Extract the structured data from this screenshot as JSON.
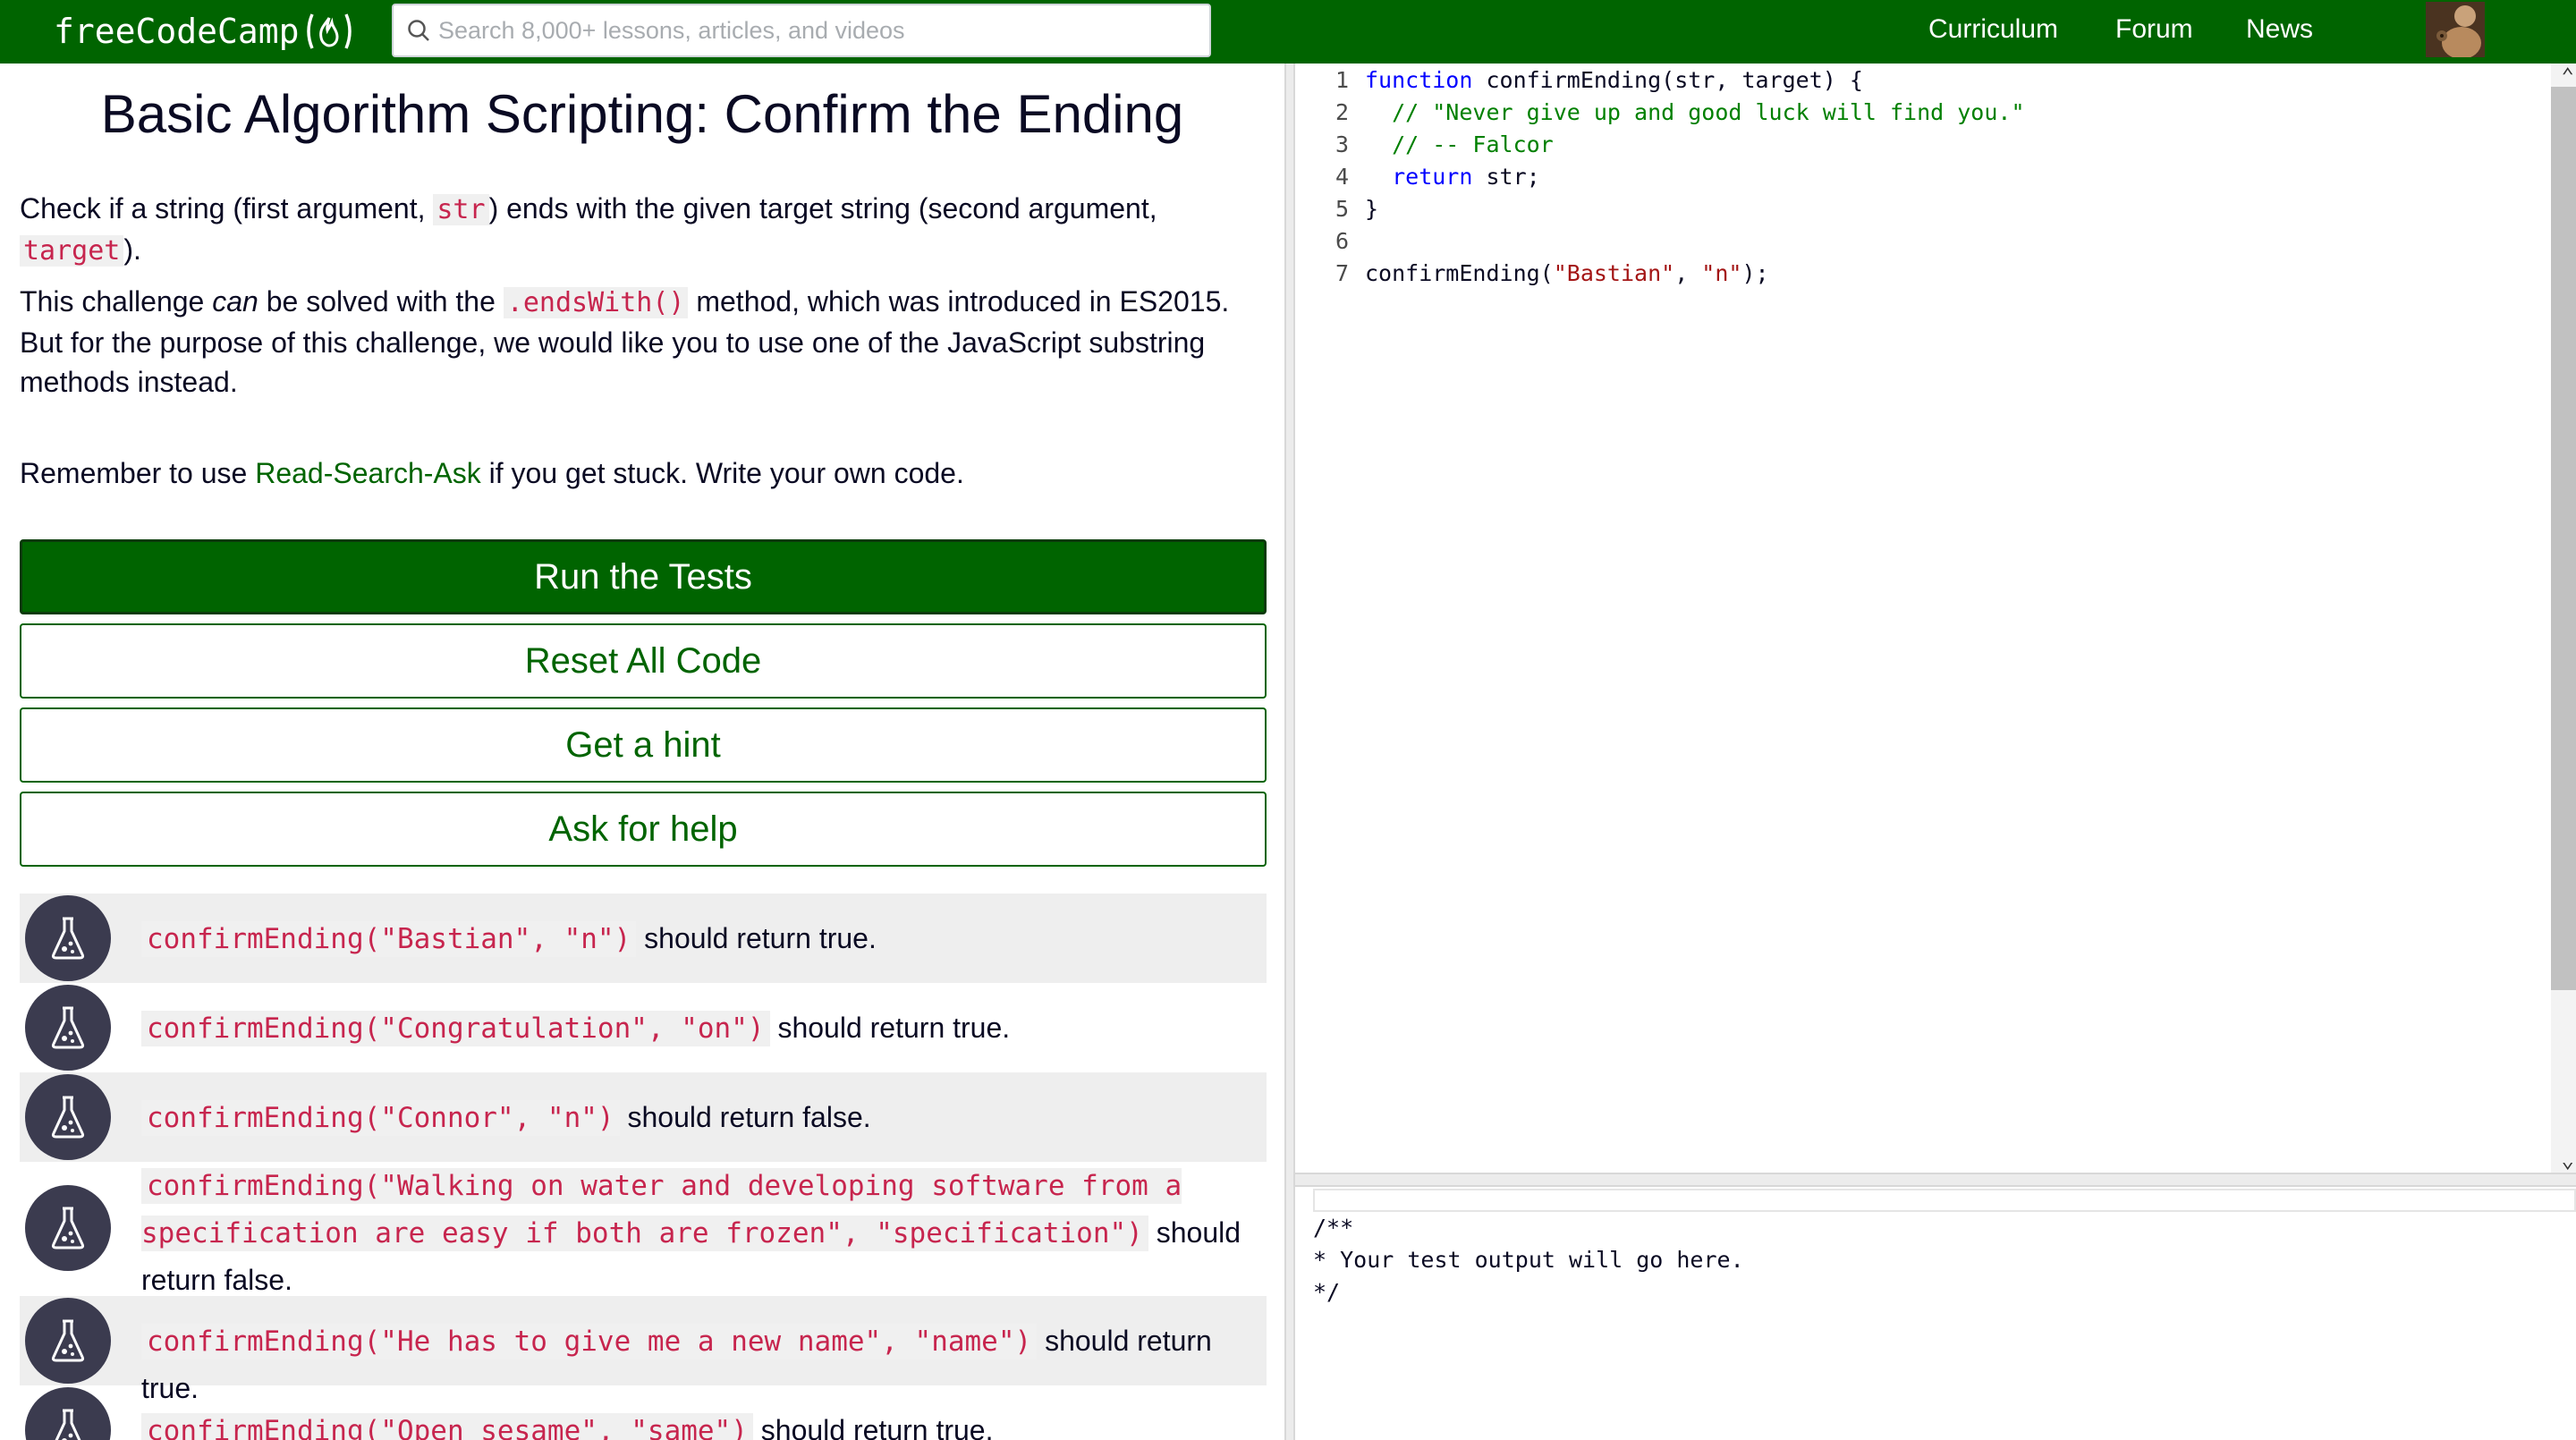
{
  "nav": {
    "logo_text": "freeCodeCamp",
    "search_placeholder": "Search 8,000+ lessons, articles, and videos",
    "links": [
      "Curriculum",
      "Forum",
      "News"
    ]
  },
  "challenge": {
    "title": "Basic Algorithm Scripting: Confirm the Ending",
    "p1_a": "Check if a string (first argument, ",
    "p1_code1": "str",
    "p1_b": ") ends with the given target string (second argument, ",
    "p1_code2": "target",
    "p1_c": ").",
    "p2_a": "This challenge ",
    "p2_em": "can",
    "p2_b": " be solved with the ",
    "p2_code": ".endsWith()",
    "p2_c": " method, which was introduced in ES2015. But for the purpose of this challenge, we would like you to use one of the JavaScript substring methods instead.",
    "p3_a": "Remember to use ",
    "p3_link": "Read-Search-Ask",
    "p3_b": " if you get stuck. Write your own code."
  },
  "buttons": {
    "run": "Run the Tests",
    "reset": "Reset All Code",
    "hint": "Get a hint",
    "help": "Ask for help"
  },
  "tests": [
    {
      "code": "confirmEnding(\"Bastian\", \"n\")",
      "text": " should return true."
    },
    {
      "code": "confirmEnding(\"Congratulation\", \"on\")",
      "text": " should return true."
    },
    {
      "code": "confirmEnding(\"Connor\", \"n\")",
      "text": " should return false."
    },
    {
      "code": "confirmEnding(\"Walking on water and developing software from a specification are easy if both are frozen\", \"specification\")",
      "text": " should return false."
    },
    {
      "code": "confirmEnding(\"He has to give me a new name\", \"name\")",
      "text": " should return true."
    },
    {
      "code": "confirmEnding(\"Open sesame\", \"same\")",
      "text": " should return true."
    }
  ],
  "editor": {
    "line_numbers": [
      "1",
      "2",
      "3",
      "4",
      "5",
      "6",
      "7"
    ],
    "l1_kw": "function",
    "l1_rest": " confirmEnding(str, target) {",
    "l2": "  // \"Never give up and good luck will find you.\"",
    "l3": "  // -- Falcor",
    "l4_kw": "  return",
    "l4_rest": " str;",
    "l5": "}",
    "l6": "",
    "l7_a": "confirmEnding(",
    "l7_s1": "\"Bastian\"",
    "l7_b": ", ",
    "l7_s2": "\"n\"",
    "l7_c": ");"
  },
  "output": {
    "l1": "/**",
    "l2": "* Your test output will go here.",
    "l3": "*/"
  }
}
